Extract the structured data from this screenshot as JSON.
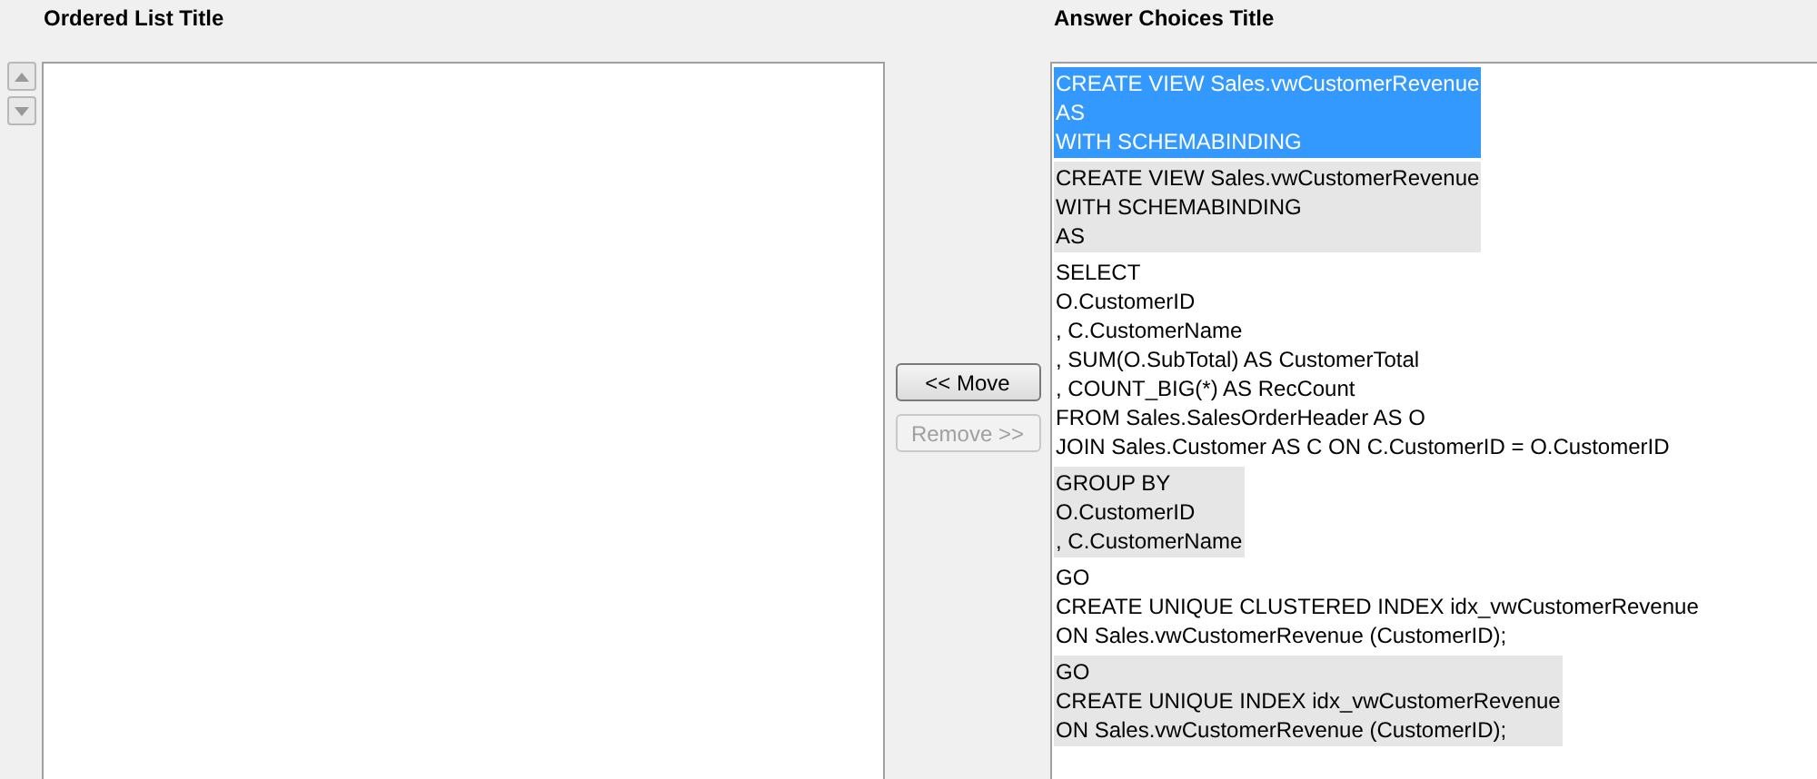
{
  "ordered_list": {
    "title": "Ordered List Title"
  },
  "buttons": [
    {
      "label": "<< Move",
      "disabled": false
    },
    {
      "label": "Remove >>",
      "disabled": true
    }
  ],
  "answer_choices": {
    "title": "Answer Choices Title",
    "items": [
      {
        "lines": [
          "CREATE VIEW Sales.vwCustomerRevenue",
          "AS",
          "WITH SCHEMABINDING"
        ],
        "selected": true
      },
      {
        "lines": [
          "CREATE VIEW Sales.vwCustomerRevenue",
          "WITH SCHEMABINDING",
          "AS"
        ],
        "selected": false
      },
      {
        "lines": [
          "SELECT",
          "O.CustomerID",
          ", C.CustomerName",
          ", SUM(O.SubTotal) AS CustomerTotal",
          ", COUNT_BIG(*) AS RecCount",
          "FROM Sales.SalesOrderHeader AS O",
          "JOIN Sales.Customer AS C ON C.CustomerID = O.CustomerID"
        ],
        "selected": false
      },
      {
        "lines": [
          "GROUP BY",
          "O.CustomerID",
          ", C.CustomerName"
        ],
        "selected": false
      },
      {
        "lines": [
          "GO",
          "CREATE UNIQUE CLUSTERED INDEX idx_vwCustomerRevenue",
          "ON Sales.vwCustomerRevenue (CustomerID);"
        ],
        "selected": false
      },
      {
        "lines": [
          "GO",
          "CREATE UNIQUE INDEX idx_vwCustomerRevenue",
          "ON Sales.vwCustomerRevenue (CustomerID);"
        ],
        "selected": false
      }
    ]
  }
}
